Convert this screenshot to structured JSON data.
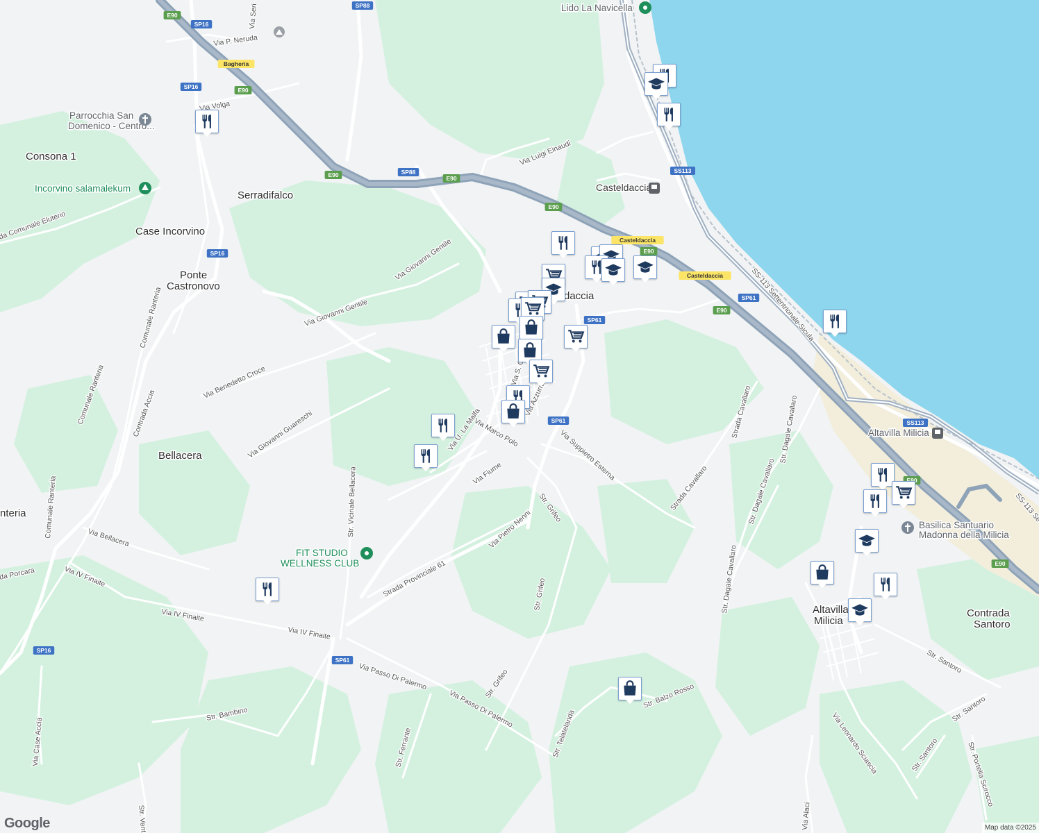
{
  "map": {
    "colors": {
      "land": "#f1f3f4",
      "green": "#d4f1e0",
      "water": "#8dd6ee",
      "motorway": "#8ea3b8",
      "road": "#ffffff",
      "icon": "#1f3a5f"
    },
    "places": [
      {
        "name": "Consona 1",
        "kind": "locality"
      },
      {
        "name": "Serradifalco",
        "kind": "locality"
      },
      {
        "name": "Case Incorvino",
        "kind": "locality"
      },
      {
        "name": "Ponte",
        "kind": "locality"
      },
      {
        "name": "Castronovo",
        "kind": "locality"
      },
      {
        "name": "Bellacera",
        "kind": "locality"
      },
      {
        "name": "nteria",
        "kind": "locality"
      },
      {
        "name": "Casteldaccia",
        "kind": "locality"
      },
      {
        "name": "Altavilla",
        "kind": "locality"
      },
      {
        "name": "Milicia",
        "kind": "locality"
      },
      {
        "name": "Contrada",
        "kind": "locality"
      },
      {
        "name": "Santoro",
        "kind": "locality"
      },
      {
        "name": "daccia",
        "kind": "locality"
      }
    ],
    "pois": [
      {
        "name": "Lido La Navicella",
        "icon": "green-pin-icon"
      },
      {
        "name": "Parrocchia San",
        "icon": "church-icon"
      },
      {
        "name": "Domenico - Centro...",
        "icon": "church-icon"
      },
      {
        "name": "Incorvino salamalekum",
        "icon": "park-icon"
      },
      {
        "name": "FIT STUDIO",
        "icon": "green-pin-icon"
      },
      {
        "name": "WELLNESS CLUB",
        "icon": "green-pin-icon"
      },
      {
        "name": "Casteldaccia",
        "icon": "train-icon"
      },
      {
        "name": "Altavilla Milicia",
        "icon": "train-icon"
      },
      {
        "name": "Basilica Santuario",
        "icon": "church-icon"
      },
      {
        "name": "Madonna della Milicia",
        "icon": "church-icon"
      }
    ],
    "roads": [
      "Via P. Neruda",
      "Via Volga",
      "Via Luigi Einaudi",
      "Via Giovanni Gentile",
      "Via Giovanni Gentile",
      "Via Benedetto Croce",
      "Via Giovanni Guareschi",
      "Comunale Ranteria",
      "Comunale Ranteria",
      "Contrada Accia",
      "Comunale Ranteria",
      "da Comunale Eluterio",
      "Via Bellacera",
      "Str. Vicinale Bellacera",
      "Via IV Finaite",
      "Via IV Finaite",
      "Via IV Finaite",
      "da Porcara",
      "Str. Bambino",
      "Via Case Accia",
      "Strada Provinciale 61",
      "Via Pietro Nenni",
      "Str. Grifeo",
      "Str. Grifeo",
      "Str. Grifeo",
      "Via Passo Di Palermo",
      "Via Passo Di Palermo",
      "Str. Ferrante",
      "Str. Telatelanda",
      "Str. Balzo Rosso",
      "Via Fiume",
      "Via Marco Polo",
      "Via U. La Malfa",
      "Via Suppietro Esterna",
      "Strada Cavallaro",
      "Strada Cavallaro",
      "Str. Dagale Cavallaro",
      "Str. Dagale Cavallaro",
      "Str. Dagale Cavallaro",
      "SS-113 Settentrionale Sicula",
      "SS-113 Se",
      "Via Leonardo Sciascia",
      "Str. Santoro",
      "Str. Santoro",
      "Str. Santoro",
      "Str. Portella Scirocco",
      "Via Alaci",
      "Str. Vent",
      "Via Seri",
      "Via S. G",
      "Via Azzurra"
    ],
    "shields": [
      {
        "text": "E90",
        "type": "green"
      },
      {
        "text": "SP16",
        "type": "blue"
      },
      {
        "text": "SP88",
        "type": "blue"
      },
      {
        "text": "Bagheria",
        "type": "yellow"
      },
      {
        "text": "SP16",
        "type": "blue"
      },
      {
        "text": "E90",
        "type": "green"
      },
      {
        "text": "E90",
        "type": "green"
      },
      {
        "text": "SP88",
        "type": "blue"
      },
      {
        "text": "E90",
        "type": "green"
      },
      {
        "text": "E90",
        "type": "green"
      },
      {
        "text": "SP16",
        "type": "blue"
      },
      {
        "text": "SS113",
        "type": "blue"
      },
      {
        "text": "Casteldaccia",
        "type": "yellow"
      },
      {
        "text": "E90",
        "type": "green"
      },
      {
        "text": "Casteldaccia",
        "type": "yellow"
      },
      {
        "text": "SP61",
        "type": "blue"
      },
      {
        "text": "E90",
        "type": "green"
      },
      {
        "text": "SP61",
        "type": "blue"
      },
      {
        "text": "SP61",
        "type": "blue"
      },
      {
        "text": "SS113",
        "type": "blue"
      },
      {
        "text": "E90",
        "type": "green"
      },
      {
        "text": "E90",
        "type": "green"
      },
      {
        "text": "SP16",
        "type": "blue"
      },
      {
        "text": "SP61",
        "type": "blue"
      }
    ],
    "markers": [
      {
        "type": "restaurant"
      },
      {
        "type": "school"
      },
      {
        "type": "restaurant"
      },
      {
        "type": "restaurant"
      },
      {
        "type": "restaurant"
      },
      {
        "type": "school"
      },
      {
        "type": "school"
      },
      {
        "type": "restaurant"
      },
      {
        "type": "school"
      },
      {
        "type": "grocery"
      },
      {
        "type": "school"
      },
      {
        "type": "grocery"
      },
      {
        "type": "grocery"
      },
      {
        "type": "restaurant"
      },
      {
        "type": "grocery"
      },
      {
        "type": "shopping"
      },
      {
        "type": "shopping"
      },
      {
        "type": "grocery"
      },
      {
        "type": "shopping"
      },
      {
        "type": "grocery"
      },
      {
        "type": "restaurant"
      },
      {
        "type": "shopping"
      },
      {
        "type": "restaurant"
      },
      {
        "type": "restaurant"
      },
      {
        "type": "restaurant"
      },
      {
        "type": "restaurant"
      },
      {
        "type": "restaurant"
      },
      {
        "type": "school"
      },
      {
        "type": "grocery"
      },
      {
        "type": "restaurant"
      },
      {
        "type": "school"
      },
      {
        "type": "shopping"
      },
      {
        "type": "restaurant"
      },
      {
        "type": "school"
      },
      {
        "type": "shopping"
      }
    ]
  },
  "footer": {
    "logo": "Google",
    "attribution": "Map data ©2025"
  }
}
